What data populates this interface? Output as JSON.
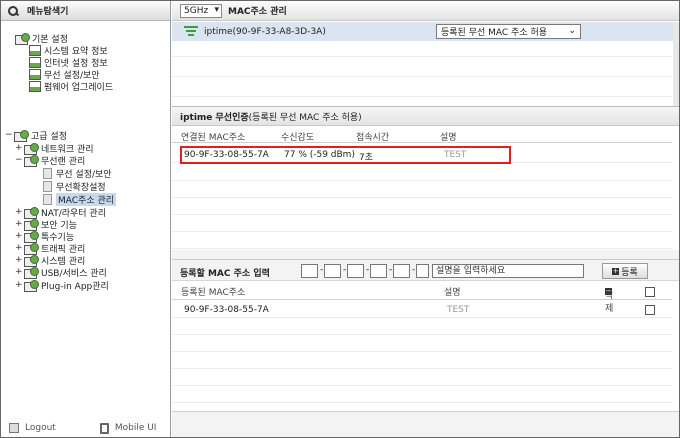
{
  "sidebar": {
    "header": "메뉴탐색기",
    "basic": {
      "label": "기본 설정",
      "items": [
        "시스템 요약 정보",
        "인터넷 설정 정보",
        "무선 설정/보안",
        "펌웨어 업그레이드"
      ]
    },
    "advanced": {
      "label": "고급 설정",
      "network": "네트워크 관리",
      "wireless": "무선랜 관리",
      "wireless_items": [
        "무선 설정/보안",
        "무선확장설정",
        "MAC주소 관리"
      ],
      "others": [
        "NAT/라우터 관리",
        "보안 기능",
        "특수기능",
        "트래픽 관리",
        "시스템 관리",
        "USB/서비스 관리",
        "Plug-in App관리"
      ]
    },
    "footer": {
      "logout": "Logout",
      "mobile": "Mobile UI"
    }
  },
  "main": {
    "band": "5GHz",
    "title": "MAC주소 관리",
    "device": "iptime(90-9F-33-A8-3D-3A)",
    "permission": "등록된 무선 MAC 주소 허용",
    "auth_section": {
      "title": "iptime 무선인증",
      "subtitle": " (등록된 무선 MAC 주소 허용)",
      "columns": [
        "연결된 MAC주소",
        "수신감도",
        "접속시간",
        "설명"
      ],
      "rows": [
        {
          "mac": "90-9F-33-08-55-7A",
          "signal": "77 % (-59 dBm)",
          "time": "7초",
          "desc": "TEST"
        }
      ]
    },
    "register": {
      "label": "등록할 MAC 주소 입력",
      "desc_value": "설명을 입력하세요",
      "add_button": "등록",
      "columns": [
        "등록된 MAC주소",
        "설명"
      ],
      "delete_label": "삭제",
      "rows": [
        {
          "mac": "90-9F-33-08-55-7A",
          "desc": "TEST"
        }
      ]
    }
  }
}
